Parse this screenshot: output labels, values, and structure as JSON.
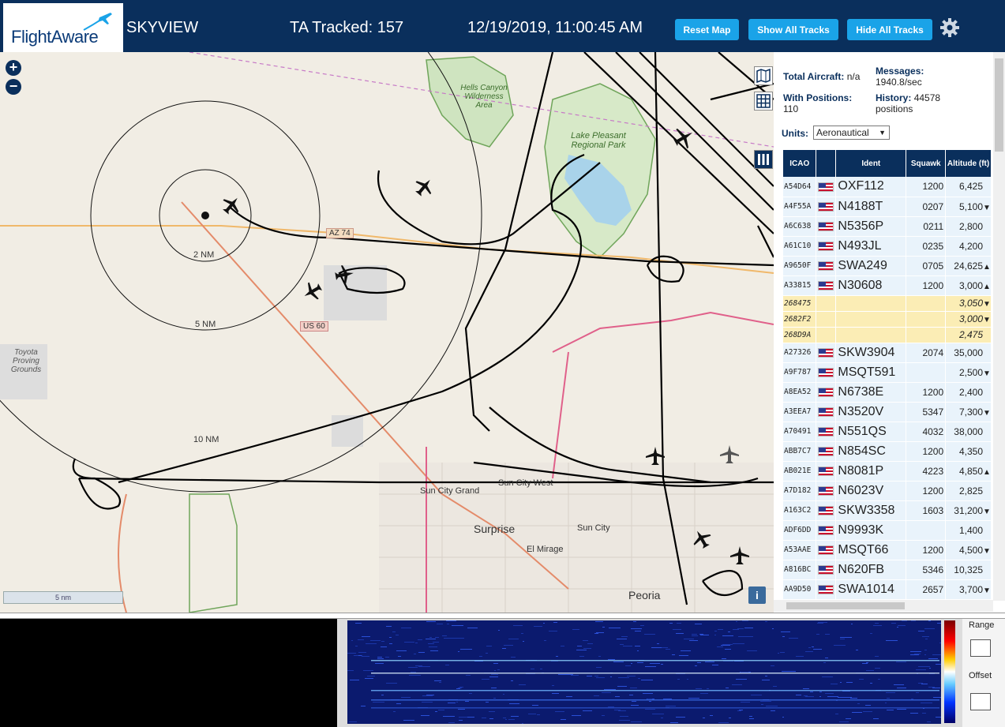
{
  "header": {
    "logo_text": "FlightAware",
    "title": "SKYVIEW",
    "tracked": "TA Tracked: 157",
    "datetime": "12/19/2019, 11:00:45 AM",
    "buttons": {
      "reset": "Reset Map",
      "show": "Show All Tracks",
      "hide": "Hide All Tracks"
    },
    "settings_icon": "gear-icon"
  },
  "map": {
    "range_labels": [
      "2 NM",
      "5 NM",
      "10 NM"
    ],
    "places": [
      "Hells Canyon Wilderness Area",
      "Lake Pleasant Regional Park",
      "Toyota Proving Grounds",
      "Sun City West",
      "Sun City Grand",
      "Surprise",
      "Sun City",
      "El Mirage",
      "Peoria"
    ],
    "roads": [
      "AZ 74",
      "US 60"
    ],
    "scale": "5 nm",
    "info": "i"
  },
  "sidebar": {
    "total_label": "Total Aircraft:",
    "total_value": "n/a",
    "messages_label": "Messages:",
    "messages_value": "1940.8/sec",
    "positions_label": "With Positions:",
    "positions_value": "110",
    "history_label": "History:",
    "history_value": "44578",
    "history_unit": "positions",
    "units_label": "Units:",
    "units_value": "Aeronautical",
    "columns": [
      "ICAO",
      "",
      "Ident",
      "Squawk",
      "Altitude (ft)"
    ],
    "rows": [
      {
        "icao": "A54D64",
        "flag": true,
        "ident": "OXF112",
        "squawk": "1200",
        "alt": "6,425",
        "trend": ""
      },
      {
        "icao": "A4F55A",
        "flag": true,
        "ident": "N4188T",
        "squawk": "0207",
        "alt": "5,100",
        "trend": "▼"
      },
      {
        "icao": "A6C638",
        "flag": true,
        "ident": "N5356P",
        "squawk": "0211",
        "alt": "2,800",
        "trend": ""
      },
      {
        "icao": "A61C10",
        "flag": true,
        "ident": "N493JL",
        "squawk": "0235",
        "alt": "4,200",
        "trend": ""
      },
      {
        "icao": "A9650F",
        "flag": true,
        "ident": "SWA249",
        "squawk": "0705",
        "alt": "24,625",
        "trend": "▲"
      },
      {
        "icao": "A33815",
        "flag": true,
        "ident": "N30608",
        "squawk": "1200",
        "alt": "3,000",
        "trend": "▲"
      },
      {
        "icao": "268475",
        "flag": false,
        "ident": "",
        "squawk": "",
        "alt": "3,050",
        "trend": "▼"
      },
      {
        "icao": "2682F2",
        "flag": false,
        "ident": "",
        "squawk": "",
        "alt": "3,000",
        "trend": "▼"
      },
      {
        "icao": "268D9A",
        "flag": false,
        "ident": "",
        "squawk": "",
        "alt": "2,475",
        "trend": ""
      },
      {
        "icao": "A27326",
        "flag": true,
        "ident": "SKW3904",
        "squawk": "2074",
        "alt": "35,000",
        "trend": ""
      },
      {
        "icao": "A9F787",
        "flag": true,
        "ident": "MSQT591",
        "squawk": "",
        "alt": "2,500",
        "trend": "▼"
      },
      {
        "icao": "A8EA52",
        "flag": true,
        "ident": "N6738E",
        "squawk": "1200",
        "alt": "2,400",
        "trend": ""
      },
      {
        "icao": "A3EEA7",
        "flag": true,
        "ident": "N3520V",
        "squawk": "5347",
        "alt": "7,300",
        "trend": "▼"
      },
      {
        "icao": "A70491",
        "flag": true,
        "ident": "N551QS",
        "squawk": "4032",
        "alt": "38,000",
        "trend": ""
      },
      {
        "icao": "ABB7C7",
        "flag": true,
        "ident": "N854SC",
        "squawk": "1200",
        "alt": "4,350",
        "trend": ""
      },
      {
        "icao": "AB021E",
        "flag": true,
        "ident": "N8081P",
        "squawk": "4223",
        "alt": "4,850",
        "trend": "▲"
      },
      {
        "icao": "A7D182",
        "flag": true,
        "ident": "N6023V",
        "squawk": "1200",
        "alt": "2,825",
        "trend": ""
      },
      {
        "icao": "A163C2",
        "flag": true,
        "ident": "SKW3358",
        "squawk": "1603",
        "alt": "31,200",
        "trend": "▼"
      },
      {
        "icao": "ADF6DD",
        "flag": true,
        "ident": "N9993K",
        "squawk": "",
        "alt": "1,400",
        "trend": ""
      },
      {
        "icao": "A53AAE",
        "flag": true,
        "ident": "MSQT66",
        "squawk": "1200",
        "alt": "4,500",
        "trend": "▼"
      },
      {
        "icao": "A816BC",
        "flag": true,
        "ident": "N620FB",
        "squawk": "5346",
        "alt": "10,325",
        "trend": ""
      },
      {
        "icao": "AA9D50",
        "flag": true,
        "ident": "SWA1014",
        "squawk": "2657",
        "alt": "3,700",
        "trend": "▼"
      }
    ]
  },
  "spectrum": {
    "range_label": "Range",
    "offset_label": "Offset"
  }
}
